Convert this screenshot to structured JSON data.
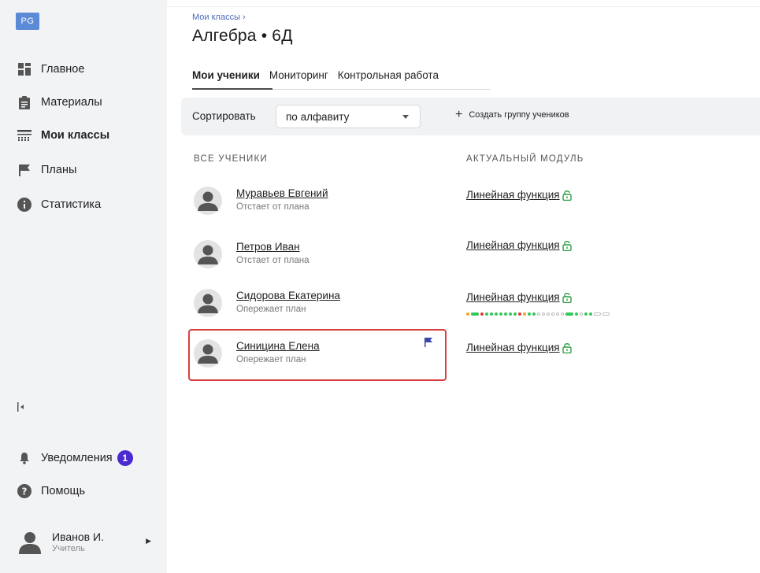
{
  "sidebar": {
    "logo": "PG",
    "items": [
      {
        "label": "Главное",
        "icon": "dashboard-icon"
      },
      {
        "label": "Материалы",
        "icon": "clipboard-icon"
      },
      {
        "label": "Мои классы",
        "icon": "classes-icon"
      },
      {
        "label": "Планы",
        "icon": "flag-icon"
      },
      {
        "label": "Статистика",
        "icon": "info-icon"
      }
    ],
    "notifications": {
      "label": "Уведомления",
      "count": "1"
    },
    "help": {
      "label": "Помощь"
    },
    "user": {
      "name": "Иванов И.",
      "role": "Учитель"
    }
  },
  "header": {
    "breadcrumb": "Мои классы ›",
    "title": "Алгебра • 6Д"
  },
  "tabs": [
    {
      "label": "Мои ученики",
      "active": true
    },
    {
      "label": "Мониторинг",
      "active": false
    },
    {
      "label": "Контрольная работа",
      "active": false
    }
  ],
  "toolbar": {
    "sort_label": "Сортировать",
    "sort_value": "по алфавиту",
    "create_group": "Создать группу учеников"
  },
  "columns": {
    "students": "ВСЕ УЧЕНИКИ",
    "module": "АКТУАЛЬНЫЙ МОДУЛЬ"
  },
  "students": [
    {
      "name": "Муравьев Евгений",
      "status": "Отстает от плана",
      "module": "Линейная функция"
    },
    {
      "name": "Петров Иван",
      "status": "Отстает от плана",
      "module": "Линейная функция"
    },
    {
      "name": "Сидорова Екатерина",
      "status": "Опережает план",
      "module": "Линейная функция"
    },
    {
      "name": "Синицина Елена",
      "status": "Опережает план",
      "module": "Линейная функция"
    }
  ],
  "progress_marks": [
    "orange",
    "green-bar",
    "red",
    "green",
    "green",
    "green",
    "green",
    "green",
    "green",
    "green",
    "red",
    "orange",
    "green",
    "green",
    "empty",
    "empty",
    "empty",
    "empty",
    "empty",
    "empty",
    "green-bar",
    "green",
    "empty",
    "green",
    "green",
    "empty-bar",
    "empty-bar"
  ],
  "colors": {
    "accent": "#4b2bd1",
    "logo": "#5b8ad6",
    "highlight": "#d84040",
    "green": "#34c759",
    "red": "#e53935",
    "orange": "#f5a623",
    "flag": "#3949ab"
  }
}
